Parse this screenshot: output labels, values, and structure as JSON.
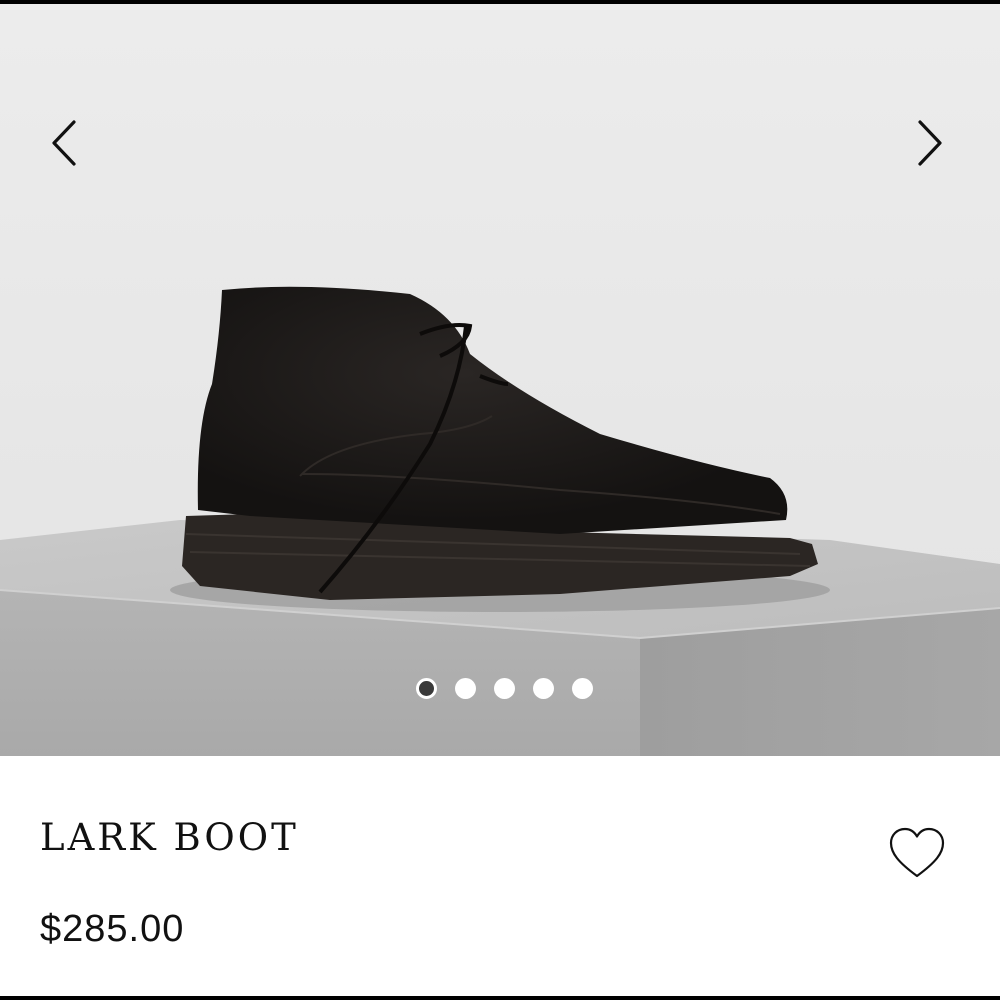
{
  "gallery": {
    "image_subject": "black suede chukka boot on grey concrete block",
    "prev_icon": "chevron-left-icon",
    "next_icon": "chevron-right-icon",
    "slide_count": 5,
    "active_slide": 1
  },
  "product": {
    "title": "LARK BOOT",
    "price": "$285.00",
    "wishlist_icon": "heart-outline-icon"
  },
  "colors": {
    "background": "#ffffff",
    "text": "#111111",
    "active_dot": "#3a3a3a",
    "inactive_dot": "#ffffff"
  }
}
